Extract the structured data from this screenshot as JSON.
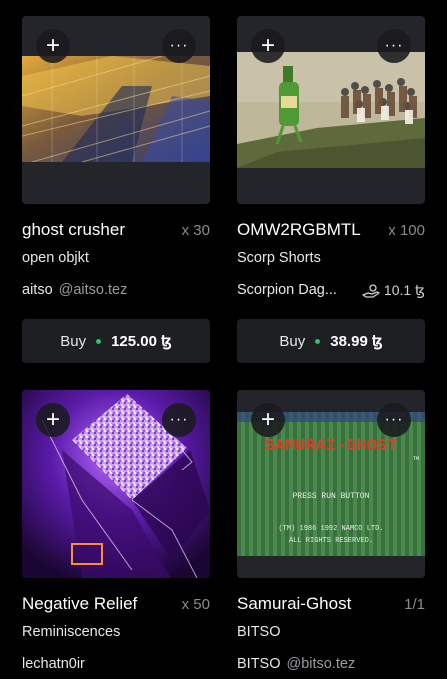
{
  "cards": [
    {
      "title": "ghost crusher",
      "edition": "x 30",
      "collection": "open objkt",
      "creator": "aitso",
      "handle": "@aitso.tez",
      "buy_label": "Buy",
      "price": "125.00 ꜩ"
    },
    {
      "title": "OMW2RGBMTL",
      "edition": "x 100",
      "collection": "Scorp Shorts",
      "creator": "Scorpion Dag...",
      "royalty": "10.1 ꜩ",
      "buy_label": "Buy",
      "price": "38.99 ꜩ"
    },
    {
      "title": "Negative Relief",
      "edition": "x 50",
      "collection": "Reminiscences",
      "creator": "lechatn0ir"
    },
    {
      "title": "Samurai-Ghost",
      "edition": "1/1",
      "collection": "BITSO",
      "creator": "BITSO",
      "handle": "@bitso.tez",
      "art_text": {
        "title": "SAMURAI-GHOST",
        "tm": "TM",
        "press": "PRESS RUN BUTTON",
        "copyright": "(TM) 1986 1992 NAMCO LTD.",
        "rights": "ALL RIGHTS RESERVED."
      }
    }
  ],
  "icons": {
    "add": "+",
    "more": "···"
  },
  "colors": {
    "background": "#000000",
    "card": "#24252a",
    "buy_bg": "#1e1f23",
    "status_dot": "#29c36a",
    "muted": "#8a8a8f"
  }
}
